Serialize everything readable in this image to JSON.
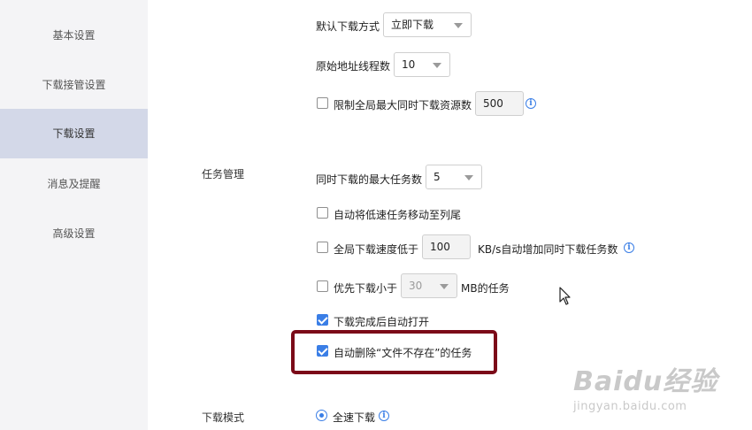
{
  "sidebar": {
    "items": [
      {
        "label": "基本设置"
      },
      {
        "label": "下载接管设置"
      },
      {
        "label": "下载设置"
      },
      {
        "label": "消息及提醒"
      },
      {
        "label": "高级设置"
      }
    ],
    "active_index": 2
  },
  "download": {
    "default_method": {
      "label": "默认下载方式",
      "value": "立即下载"
    },
    "thread_count": {
      "label": "原始地址线程数",
      "value": "10"
    },
    "limit_resources": {
      "label": "限制全局最大同时下载资源数",
      "value": "500",
      "checked": false
    }
  },
  "tasks": {
    "section_label": "任务管理",
    "max_tasks": {
      "label": "同时下载的最大任务数",
      "value": "5"
    },
    "move_slow": {
      "label": "自动将低速任务移动至列尾",
      "checked": false
    },
    "speed_below": {
      "label": "全局下载速度低于",
      "value": "100",
      "suffix": "KB/s自动增加同时下载任务数",
      "checked": false
    },
    "prefer_small": {
      "label": "优先下载小于",
      "value": "30",
      "suffix": "MB的任务",
      "checked": false
    },
    "auto_open": {
      "label": "下载完成后自动打开",
      "checked": true
    },
    "auto_delete": {
      "label": "自动删除“文件不存在”的任务",
      "checked": true
    }
  },
  "mode": {
    "section_label": "下载模式",
    "full_speed": {
      "label": "全速下载",
      "selected": true
    }
  },
  "watermark": {
    "logo": "Baidu经验",
    "url": "jingyan.baidu.com"
  },
  "colors": {
    "accent": "#3a7ee6",
    "highlight": "#7b0a18",
    "sidebar_active": "#d3d8e8"
  },
  "icons": {
    "info": "info-icon",
    "cursor": "mouse-cursor-icon"
  }
}
